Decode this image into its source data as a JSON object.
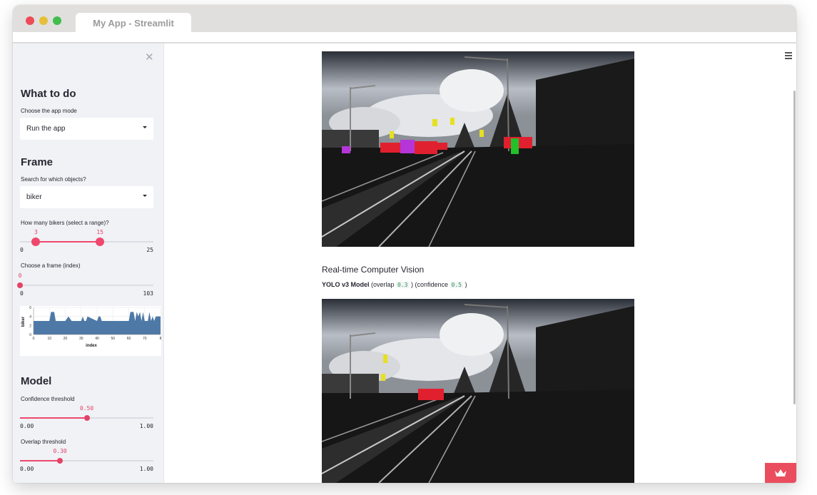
{
  "window": {
    "tab_title": "My App - Streamlit"
  },
  "sidebar": {
    "close_glyph": "✕",
    "what_to_do": {
      "heading": "What to do",
      "mode_label": "Choose the app mode",
      "mode_value": "Run the app"
    },
    "frame": {
      "heading": "Frame",
      "objects_label": "Search for which objects?",
      "objects_value": "biker",
      "range_label": "How many bikers (select a range)?",
      "range_low": "3",
      "range_high": "15",
      "range_min": "0",
      "range_max": "25",
      "range_fraction": [
        0.12,
        0.6
      ],
      "index_label": "Choose a frame (index)",
      "index_value": "0",
      "index_min": "0",
      "index_max": "103",
      "index_fraction": 0.0
    },
    "chart_data": {
      "type": "area",
      "ylabel": "biker",
      "xlabel": "index",
      "ylim": [
        0,
        6
      ],
      "yticks": [
        "0",
        "2",
        "4",
        "6"
      ],
      "xticks": [
        "0",
        "10",
        "20",
        "30",
        "40",
        "50",
        "60",
        "70",
        "8"
      ],
      "xlim": [
        0,
        80
      ],
      "x": [
        0,
        4,
        8,
        10,
        11,
        13,
        14,
        20,
        22,
        24,
        30,
        31,
        32,
        33,
        34,
        40,
        41,
        42,
        43,
        48,
        60,
        61,
        62,
        63,
        64,
        65,
        66,
        67,
        68,
        69,
        70,
        71,
        72,
        73,
        74,
        75,
        76,
        77,
        78,
        79,
        80
      ],
      "values": [
        3,
        3,
        3,
        3,
        5,
        5,
        3,
        3,
        4,
        3,
        3,
        4,
        3,
        3,
        4,
        3,
        4,
        4,
        3,
        3,
        3,
        5,
        5,
        5,
        3,
        5,
        4,
        5,
        3,
        5,
        3,
        3,
        3,
        5,
        3,
        4,
        3,
        4,
        4,
        4,
        4
      ],
      "color": "#4e79a7"
    },
    "model": {
      "heading": "Model",
      "confidence_label": "Confidence threshold",
      "confidence_value": "0.50",
      "confidence_min": "0.00",
      "confidence_max": "1.00",
      "confidence_fraction": 0.5,
      "overlap_label": "Overlap threshold",
      "overlap_value": "0.30",
      "overlap_min": "0.00",
      "overlap_max": "1.00",
      "overlap_fraction": 0.3
    }
  },
  "main": {
    "section_title": "Real-time Computer Vision",
    "model_name": "YOLO v3 Model",
    "overlap_text": " (overlap ",
    "overlap_value": "0.3",
    "confidence_text": " ) (confidence ",
    "confidence_value": "0.5",
    "close_paren": " )"
  },
  "colors": {
    "accent": "#f0476d",
    "sidebar_bg": "#f0f2f6",
    "chart_fill": "#4e79a7",
    "badge": "#ea4e5e",
    "box_red": "#e0202e",
    "box_yellow": "#e6e020",
    "box_purple": "#b535d8",
    "box_green": "#22c02a"
  },
  "icons": {
    "menu": "hamburger-icon",
    "close": "close-icon",
    "badge": "streamlit-crown-icon"
  }
}
